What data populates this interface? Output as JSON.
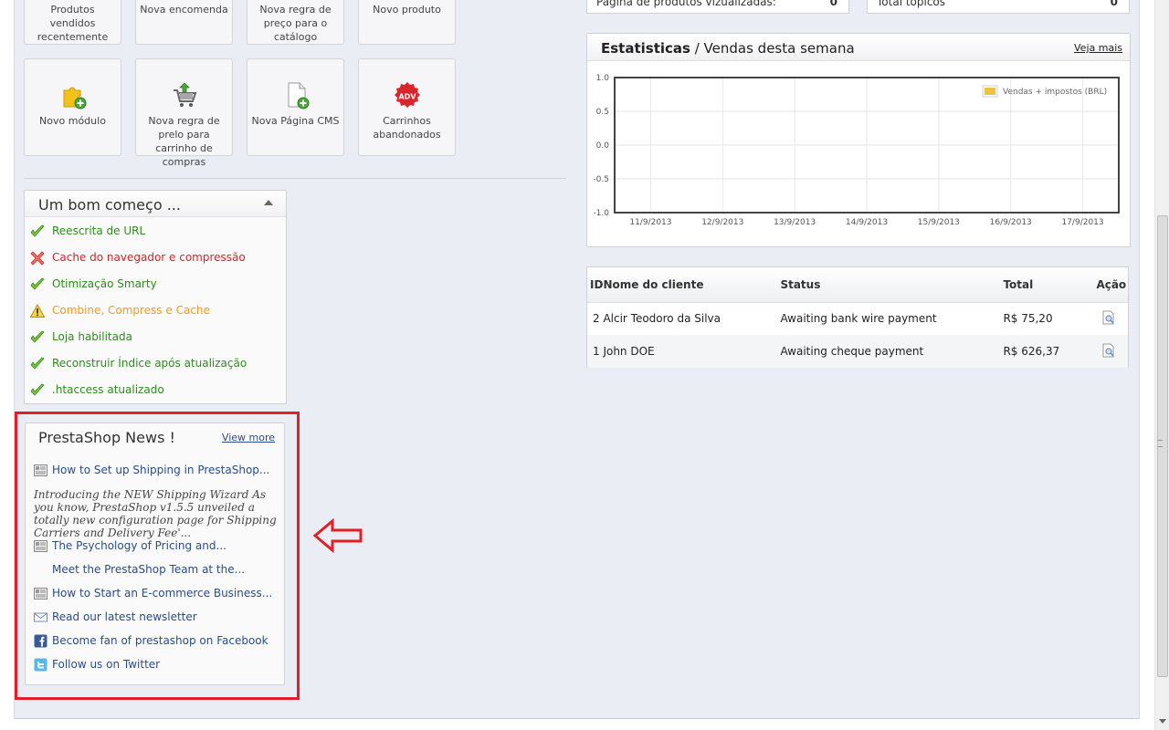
{
  "quick_access": {
    "top_row": [
      {
        "label": "Produtos vendidos recentemente"
      },
      {
        "label": "Nova encomenda"
      },
      {
        "label": "Nova regra de preço para o catálogo"
      },
      {
        "label": "Novo produto"
      }
    ],
    "bottom_row": [
      {
        "label": "Novo módulo",
        "icon": "puzzle-add-icon"
      },
      {
        "label": "Nova regra de prelo para carrinho de compras",
        "icon": "cart-add-icon"
      },
      {
        "label": "Nova Página CMS",
        "icon": "page-add-icon"
      },
      {
        "label": "Carrinhos abandonados",
        "icon": "adv-badge-icon",
        "badge_text": "ADV"
      }
    ]
  },
  "top_stats": {
    "left": {
      "label": "Página de produtos vizualizadas:",
      "value": "0"
    },
    "right": {
      "label": "Total tópicos",
      "value": "0"
    }
  },
  "good_start": {
    "title": "Um bom começo ...",
    "items": [
      {
        "label": "Reescrita de URL",
        "status": "ok"
      },
      {
        "label": "Cache do navegador e compressão",
        "status": "error"
      },
      {
        "label": "Otimização Smarty",
        "status": "ok"
      },
      {
        "label": "Combine, Compress e Cache",
        "status": "warning"
      },
      {
        "label": "Loja habilitada",
        "status": "ok"
      },
      {
        "label": "Reconstruir Índice após atualização",
        "status": "ok"
      },
      {
        "label": ".htaccess atualizado",
        "status": "ok"
      }
    ]
  },
  "news": {
    "title": "PrestaShop News !",
    "view_more": "View more",
    "links": [
      {
        "label": "How to Set up Shipping in PrestaShop...",
        "icon": "article-icon"
      },
      {
        "label": "The Psychology of Pricing and...",
        "icon": "article-icon"
      },
      {
        "label": "Meet the PrestaShop Team at the...",
        "icon": ""
      },
      {
        "label": "How to Start an E-commerce Business...",
        "icon": "article-icon"
      },
      {
        "label": "Read our latest newsletter",
        "icon": "envelope-icon"
      },
      {
        "label": "Become fan of prestashop on Facebook",
        "icon": "facebook-icon"
      },
      {
        "label": "Follow us on Twitter",
        "icon": "twitter-icon"
      }
    ],
    "description": "Introducing the NEW Shipping Wizard As you know, PrestaShop v1.5.5 unveiled a totally new configuration page for Shipping Carriers and Delivery Fee'..."
  },
  "stats": {
    "title_bold": "Estatisticas",
    "title_rest": " / Vendas desta semana",
    "view_more": "Veja mais"
  },
  "chart_data": {
    "type": "line",
    "title": "Estatisticas / Vendas desta semana",
    "categories": [
      "11/9/2013",
      "12/9/2013",
      "13/9/2013",
      "14/9/2013",
      "15/9/2013",
      "16/9/2013",
      "17/9/2013"
    ],
    "yticks": [
      "1.0",
      "0.5",
      "0.0",
      "-0.5",
      "-1.0"
    ],
    "ylim": [
      -1.0,
      1.0
    ],
    "series": [
      {
        "name": "Vendas + impostos (BRL)",
        "values": [],
        "color": "#edc240"
      }
    ],
    "grid": true,
    "legend": "top-right"
  },
  "orders": {
    "headers": {
      "id": "ID",
      "customer": "Nome do cliente",
      "status": "Status",
      "total": "Total",
      "action": "Ação"
    },
    "rows": [
      {
        "id": "2",
        "customer": "Alcir Teodoro da Silva",
        "status": "Awaiting bank wire payment",
        "total": "R$ 75,20"
      },
      {
        "id": "1",
        "customer": "John DOE",
        "status": "Awaiting cheque payment",
        "total": "R$ 626,37"
      }
    ]
  },
  "colors": {
    "accent_red": "#e01f26",
    "link": "#2a4c8a",
    "ok": "#2f8a1e",
    "error": "#d8222b",
    "warning": "#f59a1c"
  }
}
